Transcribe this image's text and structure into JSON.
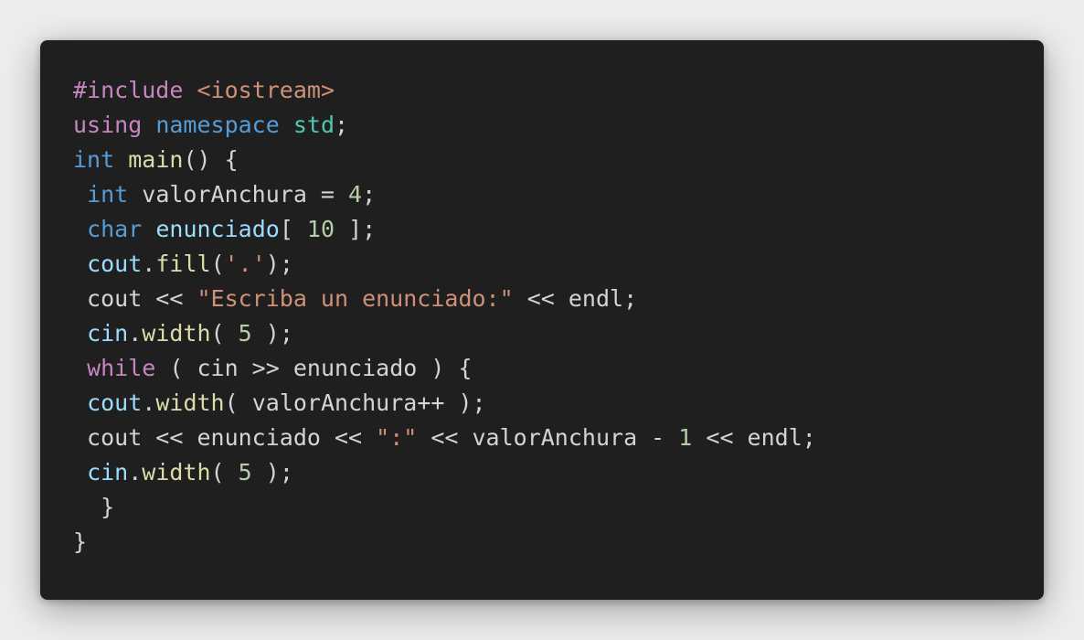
{
  "colors": {
    "background": "#ededed",
    "panel": "#1f1f1f",
    "default": "#d4d4d4",
    "preproc": "#c586c0",
    "include": "#ce9178",
    "keyword": "#c586c0",
    "type": "#569cd6",
    "namespace_name": "#4ec9b0",
    "function": "#dcdcaa",
    "variable": "#9cdcfe",
    "number": "#b5cea8",
    "string": "#ce9178"
  },
  "code": {
    "lines": [
      [
        {
          "text": "#include",
          "kind": "preproc"
        },
        {
          "text": " ",
          "kind": "default"
        },
        {
          "text": "<iostream>",
          "kind": "include"
        }
      ],
      [
        {
          "text": "using",
          "kind": "kw"
        },
        {
          "text": " ",
          "kind": "default"
        },
        {
          "text": "namespace",
          "kind": "ns"
        },
        {
          "text": " ",
          "kind": "default"
        },
        {
          "text": "std",
          "kind": "nsname"
        },
        {
          "text": ";",
          "kind": "default"
        }
      ],
      [
        {
          "text": "int",
          "kind": "type"
        },
        {
          "text": " ",
          "kind": "default"
        },
        {
          "text": "main",
          "kind": "func"
        },
        {
          "text": "() {",
          "kind": "default"
        }
      ],
      [
        {
          "text": " ",
          "kind": "default"
        },
        {
          "text": "int",
          "kind": "type"
        },
        {
          "text": " valorAnchura = ",
          "kind": "default"
        },
        {
          "text": "4",
          "kind": "num"
        },
        {
          "text": ";",
          "kind": "default"
        }
      ],
      [
        {
          "text": " ",
          "kind": "default"
        },
        {
          "text": "char",
          "kind": "type"
        },
        {
          "text": " ",
          "kind": "default"
        },
        {
          "text": "enunciado",
          "kind": "var"
        },
        {
          "text": "[ ",
          "kind": "default"
        },
        {
          "text": "10",
          "kind": "num"
        },
        {
          "text": " ];",
          "kind": "default"
        }
      ],
      [
        {
          "text": " ",
          "kind": "default"
        },
        {
          "text": "cout",
          "kind": "var"
        },
        {
          "text": ".",
          "kind": "default"
        },
        {
          "text": "fill",
          "kind": "func"
        },
        {
          "text": "(",
          "kind": "default"
        },
        {
          "text": "'.'",
          "kind": "str"
        },
        {
          "text": ");",
          "kind": "default"
        }
      ],
      [
        {
          "text": " cout << ",
          "kind": "default"
        },
        {
          "text": "\"Escriba un enunciado:\"",
          "kind": "str"
        },
        {
          "text": " << endl;",
          "kind": "default"
        }
      ],
      [
        {
          "text": " ",
          "kind": "default"
        },
        {
          "text": "cin",
          "kind": "var"
        },
        {
          "text": ".",
          "kind": "default"
        },
        {
          "text": "width",
          "kind": "func"
        },
        {
          "text": "( ",
          "kind": "default"
        },
        {
          "text": "5",
          "kind": "num"
        },
        {
          "text": " );",
          "kind": "default"
        }
      ],
      [
        {
          "text": " ",
          "kind": "default"
        },
        {
          "text": "while",
          "kind": "kw"
        },
        {
          "text": " ( cin >> enunciado ) {",
          "kind": "default"
        }
      ],
      [
        {
          "text": " ",
          "kind": "default"
        },
        {
          "text": "cout",
          "kind": "var"
        },
        {
          "text": ".",
          "kind": "default"
        },
        {
          "text": "width",
          "kind": "func"
        },
        {
          "text": "( valorAnchura++ );",
          "kind": "default"
        }
      ],
      [
        {
          "text": " cout << enunciado << ",
          "kind": "default"
        },
        {
          "text": "\":\"",
          "kind": "str"
        },
        {
          "text": " << valorAnchura - ",
          "kind": "default"
        },
        {
          "text": "1",
          "kind": "num"
        },
        {
          "text": " << endl;",
          "kind": "default"
        }
      ],
      [
        {
          "text": " ",
          "kind": "default"
        },
        {
          "text": "cin",
          "kind": "var"
        },
        {
          "text": ".",
          "kind": "default"
        },
        {
          "text": "width",
          "kind": "func"
        },
        {
          "text": "( ",
          "kind": "default"
        },
        {
          "text": "5",
          "kind": "num"
        },
        {
          "text": " );",
          "kind": "default"
        }
      ],
      [
        {
          "text": "  }",
          "kind": "default"
        }
      ],
      [
        {
          "text": "}",
          "kind": "default"
        }
      ]
    ]
  }
}
